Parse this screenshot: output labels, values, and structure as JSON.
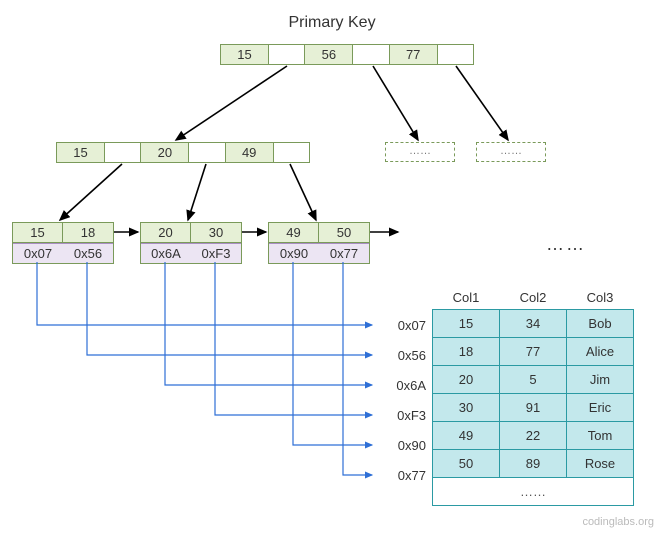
{
  "title": "Primary Key",
  "root": {
    "k0": "15",
    "k1": "56",
    "k2": "77"
  },
  "level1": {
    "k0": "15",
    "k1": "20",
    "k2": "49"
  },
  "dashed": {
    "d0": "……",
    "d1": "……"
  },
  "leaf0": {
    "k0": "15",
    "k1": "18",
    "p0": "0x07",
    "p1": "0x56"
  },
  "leaf1": {
    "k0": "20",
    "k1": "30",
    "p0": "0x6A",
    "p1": "0xF3"
  },
  "leaf2": {
    "k0": "49",
    "k1": "50",
    "p0": "0x90",
    "p1": "0x77"
  },
  "leaf_ellipsis": "……",
  "table_headers": {
    "c1": "Col1",
    "c2": "Col2",
    "c3": "Col3"
  },
  "rows": [
    {
      "addr": "0x07",
      "c1": "15",
      "c2": "34",
      "c3": "Bob"
    },
    {
      "addr": "0x56",
      "c1": "18",
      "c2": "77",
      "c3": "Alice"
    },
    {
      "addr": "0x6A",
      "c1": "20",
      "c2": "5",
      "c3": "Jim"
    },
    {
      "addr": "0xF3",
      "c1": "30",
      "c2": "91",
      "c3": "Eric"
    },
    {
      "addr": "0x90",
      "c1": "49",
      "c2": "22",
      "c3": "Tom"
    },
    {
      "addr": "0x77",
      "c1": "50",
      "c2": "89",
      "c3": "Rose"
    }
  ],
  "table_ellipsis": "……",
  "watermark": "codinglabs.org"
}
